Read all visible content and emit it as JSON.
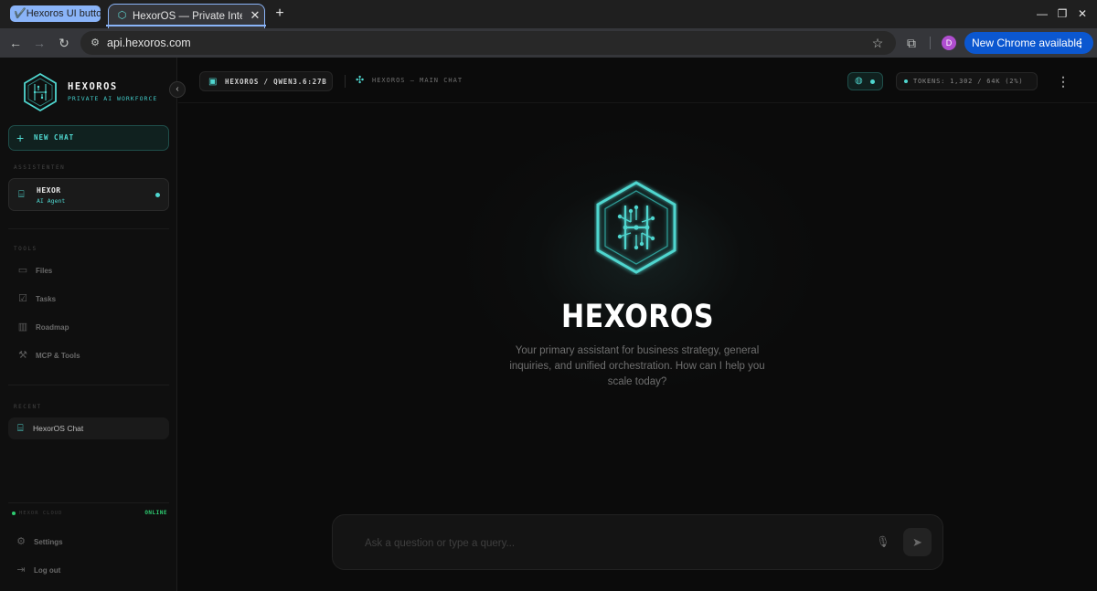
{
  "browser": {
    "tab_group_label": "✔️Hexoros UI buttons",
    "active_tab_title": "HexorOS — Private Intelligence",
    "url": "api.hexoros.com",
    "update_label": "New Chrome available",
    "profile_initial": "D"
  },
  "sidebar": {
    "brand_name": "HEXOROS",
    "brand_sub": "PRIVATE AI WORKFORCE",
    "new_chat_label": "NEW CHAT",
    "assistants_heading": "ASSISTENTEN",
    "agent": {
      "name": "HEXOR",
      "role": "AI Agent"
    },
    "tools_heading": "TOOLS",
    "tools": [
      {
        "label": "Files",
        "icon": "folder-icon"
      },
      {
        "label": "Tasks",
        "icon": "checkbox-icon"
      },
      {
        "label": "Roadmap",
        "icon": "map-icon"
      },
      {
        "label": "MCP & Tools",
        "icon": "wrench-icon"
      }
    ],
    "recent_heading": "RECENT",
    "recent": [
      {
        "label": "HexorOS Chat"
      }
    ],
    "status_label": "HEXOR CLOUD",
    "status_value": "ONLINE",
    "footer": [
      {
        "label": "Settings",
        "icon": "gear-icon"
      },
      {
        "label": "Log out",
        "icon": "logout-icon"
      }
    ]
  },
  "topbar": {
    "model_label": "HEXOROS / QWEN3.6:27B",
    "chat_title": "HEXOROS — MAIN CHAT",
    "tokens_label": "TOKENS: 1,302 / 64K (2%)"
  },
  "hero": {
    "title": "HEXOROS",
    "description": "Your primary assistant for business strategy, general inquiries, and unified orchestration. How can I help you scale today?"
  },
  "composer": {
    "placeholder": "Ask a question or type a query..."
  },
  "colors": {
    "accent": "#4fd6cf",
    "online": "#2ecc71",
    "chrome_update": "#0b57d0"
  }
}
